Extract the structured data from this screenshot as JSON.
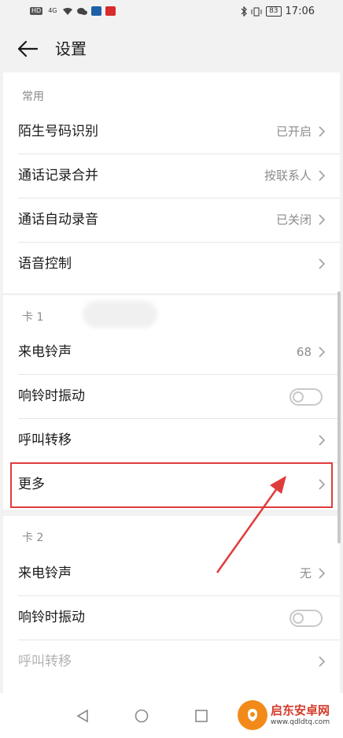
{
  "status_bar": {
    "left_badges": [
      "HD",
      "4G"
    ],
    "time": "17:06",
    "battery": "83"
  },
  "header": {
    "title": "设置"
  },
  "common_section": {
    "header": "常用",
    "items": [
      {
        "label": "陌生号码识别",
        "value": "已开启"
      },
      {
        "label": "通话记录合并",
        "value": "按联系人"
      },
      {
        "label": "通话自动录音",
        "value": "已关闭"
      },
      {
        "label": "语音控制",
        "value": ""
      }
    ]
  },
  "sim1_section": {
    "header": "卡 1",
    "items": [
      {
        "label": "来电铃声",
        "value": "68"
      },
      {
        "label": "响铃时振动",
        "toggle": false
      },
      {
        "label": "呼叫转移",
        "value": ""
      },
      {
        "label": "更多",
        "value": ""
      }
    ]
  },
  "sim2_section": {
    "header": "卡 2",
    "items": [
      {
        "label": "来电铃声",
        "value": "无"
      },
      {
        "label": "响铃时振动",
        "toggle": false
      },
      {
        "label": "呼叫转移",
        "value": "",
        "disabled": true
      }
    ]
  },
  "watermark": {
    "title": "启东安卓网",
    "url": "www.qdldtq.com"
  },
  "colors": {
    "highlight": "#e03b3b",
    "watermark_orange": "#f28a1a"
  },
  "icons": [
    "back-arrow-icon",
    "chevron-right-icon",
    "nav-back-icon",
    "nav-home-icon",
    "nav-recents-icon"
  ]
}
